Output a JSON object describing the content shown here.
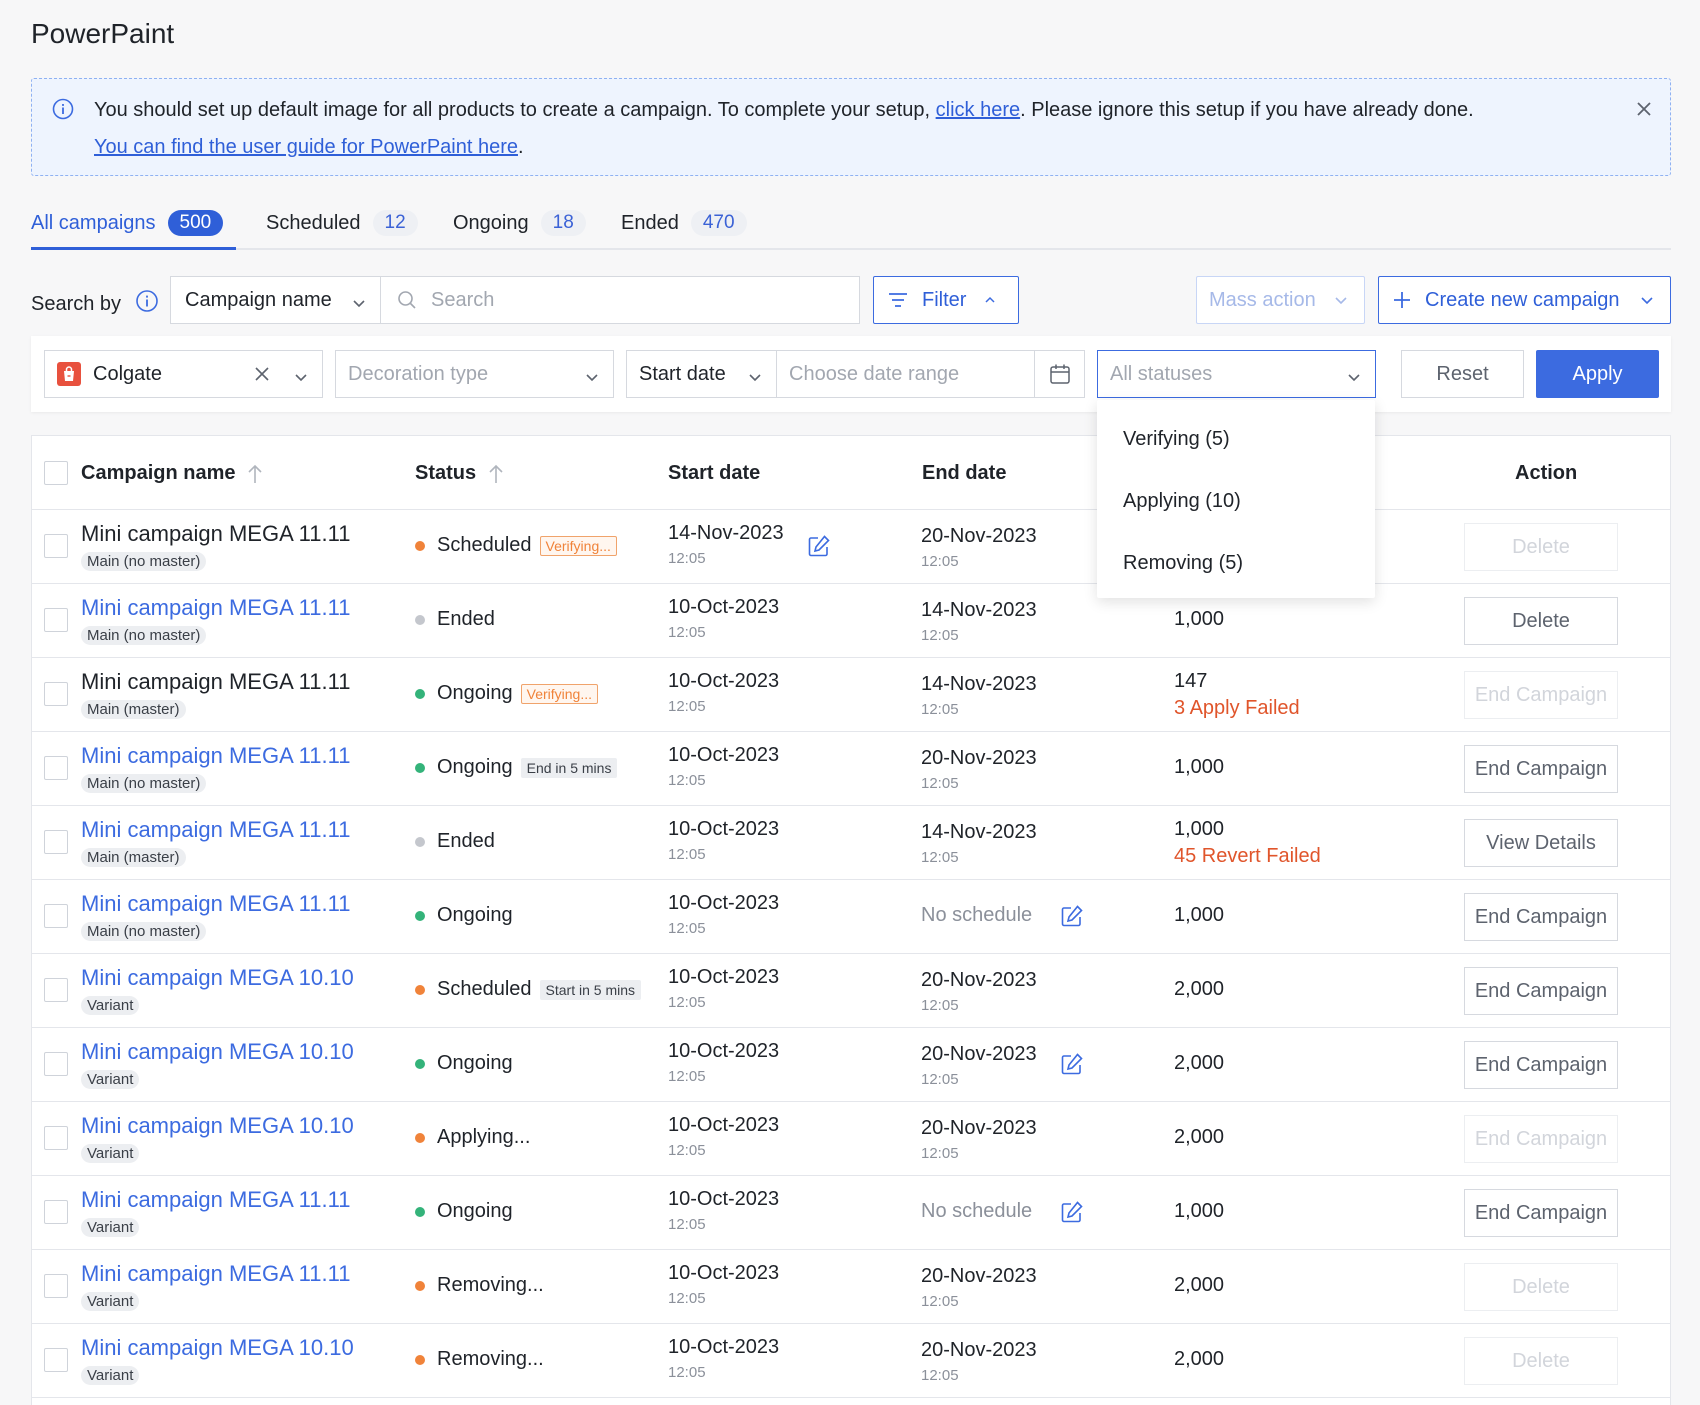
{
  "app": {
    "title": "PowerPaint"
  },
  "notice": {
    "text_before": "You should set up default image for all products to create a campaign. To complete your setup, ",
    "link1": "click here",
    "text_after": ". Please ignore this setup if you have already done.",
    "link2": "You can find the user guide for PowerPaint here",
    "line2_suffix": "."
  },
  "tabs": [
    {
      "label": "All campaigns",
      "count": "500",
      "active": true
    },
    {
      "label": "Scheduled",
      "count": "12"
    },
    {
      "label": "Ongoing",
      "count": "18"
    },
    {
      "label": "Ended",
      "count": "470"
    }
  ],
  "search": {
    "label": "Search by",
    "field_value": "Campaign name",
    "placeholder": "Search",
    "filter_label": "Filter",
    "mass_action_label": "Mass action",
    "create_label": "Create new campaign"
  },
  "filters": {
    "shop_value": "Colgate",
    "decoration_placeholder": "Decoration type",
    "date_field_value": "Start date",
    "date_range_placeholder": "Choose date range",
    "status_placeholder": "All statuses",
    "reset_label": "Reset",
    "apply_label": "Apply"
  },
  "status_dropdown": {
    "options": [
      "Verifying (5)",
      "Applying (10)",
      "Removing (5)"
    ]
  },
  "table": {
    "headers": {
      "campaign_name": "Campaign name",
      "status": "Status",
      "start_date": "Start date",
      "end_date": "End date",
      "action": "Action"
    },
    "rows": [
      {
        "name": "Mini campaign MEGA 11.11",
        "tag": "Main (no master)",
        "status": "Scheduled",
        "badge": "Verifying...",
        "start": "14-Nov-2023",
        "start_time": "12:05",
        "end": "20-Nov-2023",
        "end_time": "12:05",
        "products": "",
        "action": "Delete"
      },
      {
        "name": "Mini campaign MEGA 11.11",
        "tag": "Main (no master)",
        "status": "Ended",
        "start": "10-Oct-2023",
        "start_time": "12:05",
        "end": "14-Nov-2023",
        "end_time": "12:05",
        "products": "1,000",
        "action": "Delete"
      },
      {
        "name": "Mini campaign MEGA 11.11",
        "tag": "Main (master)",
        "status": "Ongoing",
        "badge": "Verifying...",
        "start": "10-Oct-2023",
        "start_time": "12:05",
        "end": "14-Nov-2023",
        "end_time": "12:05",
        "products": "147",
        "fail": "3 Apply Failed",
        "action": "End Campaign"
      },
      {
        "name": "Mini campaign MEGA 11.11",
        "tag": "Main (no master)",
        "status": "Ongoing",
        "badge": "End in 5 mins",
        "start": "10-Oct-2023",
        "start_time": "12:05",
        "end": "20-Nov-2023",
        "end_time": "12:05",
        "products": "1,000",
        "action": "End Campaign"
      },
      {
        "name": "Mini campaign MEGA 11.11",
        "tag": "Main (master)",
        "status": "Ended",
        "start": "10-Oct-2023",
        "start_time": "12:05",
        "end": "14-Nov-2023",
        "end_time": "12:05",
        "products": "1,000",
        "fail": "45 Revert Failed",
        "action": "View Details"
      },
      {
        "name": "Mini campaign MEGA 11.11",
        "tag": "Main (no master)",
        "status": "Ongoing",
        "start": "10-Oct-2023",
        "start_time": "12:05",
        "end": "No schedule",
        "end_time": "",
        "products": "1,000",
        "action": "End Campaign"
      },
      {
        "name": "Mini campaign MEGA 10.10",
        "tag": "Variant",
        "status": "Scheduled",
        "badge": "Start in 5 mins",
        "start": "10-Oct-2023",
        "start_time": "12:05",
        "end": "20-Nov-2023",
        "end_time": "12:05",
        "products": "2,000",
        "action": "End Campaign"
      },
      {
        "name": "Mini campaign MEGA 10.10",
        "tag": "Variant",
        "status": "Ongoing",
        "start": "10-Oct-2023",
        "start_time": "12:05",
        "end": "20-Nov-2023",
        "end_time": "12:05",
        "products": "2,000",
        "action": "End Campaign"
      },
      {
        "name": "Mini campaign MEGA 10.10",
        "tag": "Variant",
        "status": "Applying...",
        "start": "10-Oct-2023",
        "start_time": "12:05",
        "end": "20-Nov-2023",
        "end_time": "12:05",
        "products": "2,000",
        "action": "End Campaign"
      },
      {
        "name": "Mini campaign MEGA 11.11",
        "tag": "Variant",
        "status": "Ongoing",
        "start": "10-Oct-2023",
        "start_time": "12:05",
        "end": "No schedule",
        "end_time": "",
        "products": "1,000",
        "action": "End Campaign"
      },
      {
        "name": "Mini campaign MEGA 11.11",
        "tag": "Variant",
        "status": "Removing...",
        "start": "10-Oct-2023",
        "start_time": "12:05",
        "end": "20-Nov-2023",
        "end_time": "12:05",
        "products": "2,000",
        "action": "Delete"
      },
      {
        "name": "Mini campaign MEGA 10.10",
        "tag": "Variant",
        "status": "Removing...",
        "start": "10-Oct-2023",
        "start_time": "12:05",
        "end": "20-Nov-2023",
        "end_time": "12:05",
        "products": "2,000",
        "action": "Delete"
      }
    ]
  },
  "colors": {
    "primary": "#3c6be0",
    "dot_orange": "#f0833a",
    "dot_green": "#34b37a",
    "dot_grey": "#c4c7cd",
    "fail_red": "#e0552b",
    "shop_icon": "#e8513e"
  }
}
